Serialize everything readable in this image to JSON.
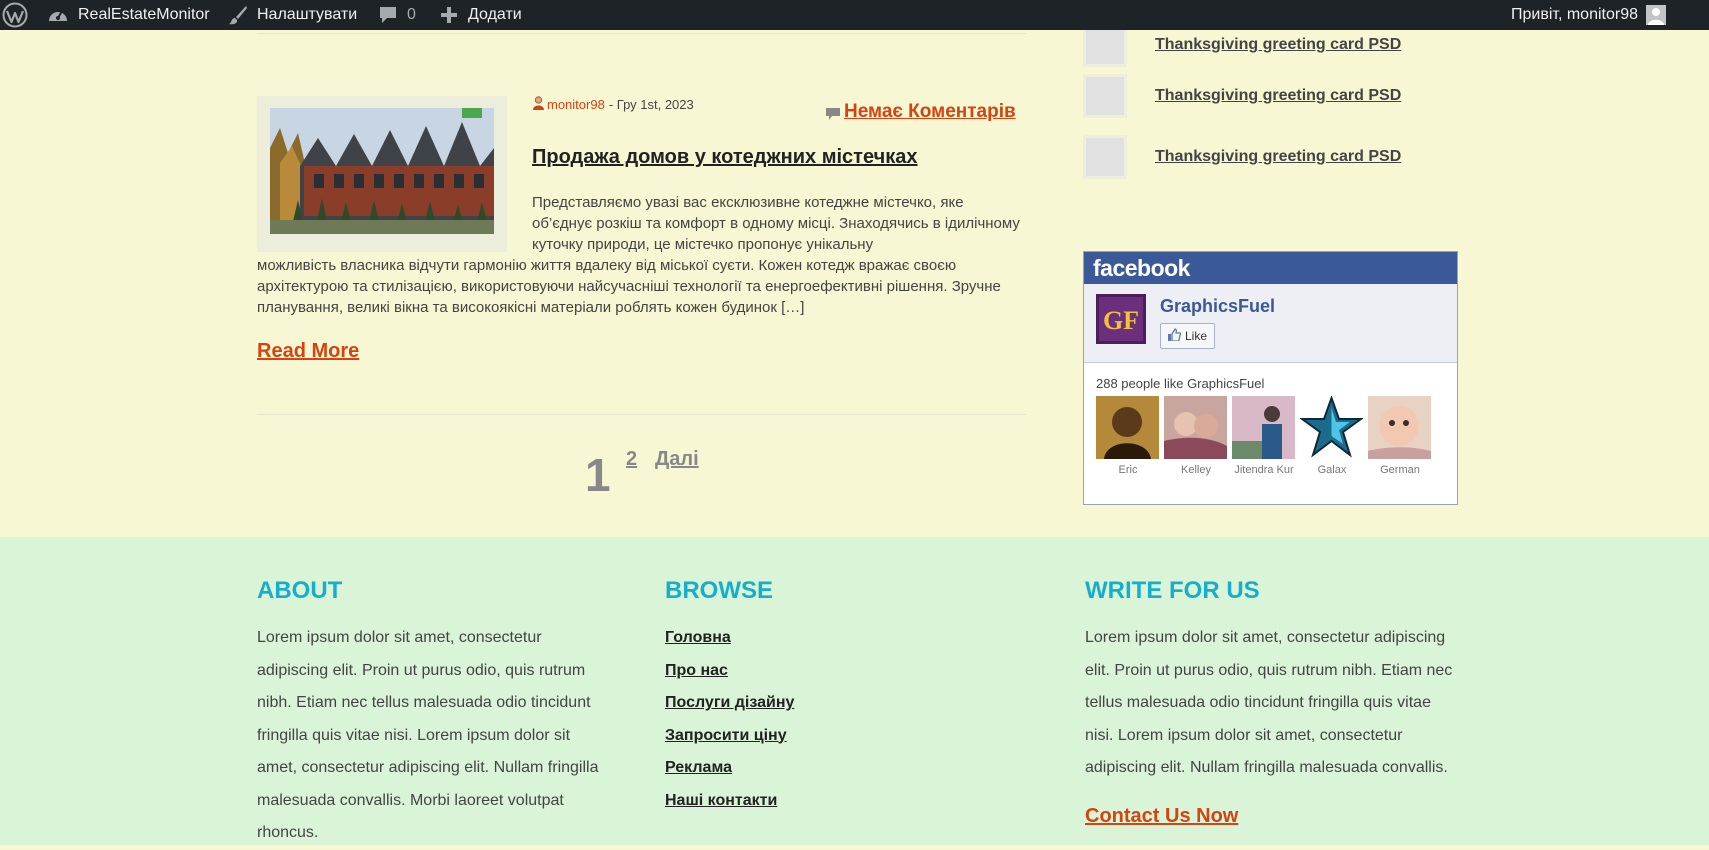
{
  "adminbar": {
    "site_name": "RealEstateMonitor",
    "customize": "Налаштувати",
    "comments_count": "0",
    "add_new": "Додати",
    "greeting": "Привіт, monitor98"
  },
  "post": {
    "author": "monitor98",
    "date": "- Гру 1st, 2023",
    "comments": "Немає Коментарів",
    "title": "Продажа домов у котеджних містечках",
    "excerpt_1": "Представляємо увазі вас ексклюзивне котеджне містечко, яке об’єднує розкіш та комфорт в одному місці. Знаходячись в ідилічному куточку природи, це містечко пропонує унікальну",
    "excerpt_2": "можливість власника відчути гармонію життя вдалеку від міської суєти. Кожен котедж вражає своєю архітектурою та стилізацією, використовуючи найсучасніші технології та енергоефективні рішення. Зручне планування, великі вікна та високоякісні матеріали роблять кожен будинок […]",
    "read_more": "Read More"
  },
  "pagination": {
    "current": "1",
    "page2": "2",
    "next": "Далі"
  },
  "sidebar": {
    "items": [
      {
        "label": "Thanksgiving greeting card PSD"
      },
      {
        "label": "Thanksgiving greeting card PSD"
      },
      {
        "label": "Thanksgiving greeting card PSD"
      }
    ],
    "facebook": {
      "brand": "facebook",
      "page_name": "GraphicsFuel",
      "logo_text": "GF",
      "like_label": "Like",
      "count_text": "288 people like GraphicsFuel",
      "fans": [
        "Eric",
        "Kelley",
        "Jitendra Kur",
        "Galax",
        "German"
      ]
    }
  },
  "footer": {
    "about": {
      "title": "ABOUT",
      "text": "Lorem ipsum dolor sit amet, consectetur adipiscing elit. Proin ut purus odio, quis rutrum nibh. Etiam nec tellus malesuada odio tincidunt fringilla quis vitae nisi. Lorem ipsum dolor sit amet, consectetur adipiscing elit. Nullam fringilla malesuada convallis. Morbi laoreet volutpat rhoncus."
    },
    "browse": {
      "title": "BROWSE",
      "links": [
        "Головна",
        "Про нас",
        "Послуги дізайну",
        "Запросити ціну",
        "Реклама",
        "Наші контакти"
      ]
    },
    "write": {
      "title": "WRITE FOR US",
      "text": "Lorem ipsum dolor sit amet, consectetur adipiscing elit. Proin ut purus odio, quis rutrum nibh. Etiam nec tellus malesuada odio tincidunt fringilla quis vitae nisi. Lorem ipsum dolor sit amet, consectetur adipiscing elit. Nullam fringilla malesuada convallis.",
      "cta": "Contact Us Now"
    }
  },
  "colors": {
    "adminbar": "#1d2327",
    "page_bg": "#f7f7d3",
    "footer_bg": "#d9f4d7",
    "accent_link": "#d44310",
    "footer_heading": "#17aecb",
    "facebook_blue": "#3b5998"
  },
  "icons": {
    "wp_logo": "wordpress-logo-icon",
    "dashboard": "dashboard-gauge-icon",
    "customize": "paintbrush-icon",
    "comments": "speech-bubble-icon",
    "add": "plus-icon",
    "avatar": "user-avatar-icon",
    "author": "user-small-icon",
    "comment_bubble": "comment-bubble-icon",
    "like": "thumbs-up-icon"
  }
}
